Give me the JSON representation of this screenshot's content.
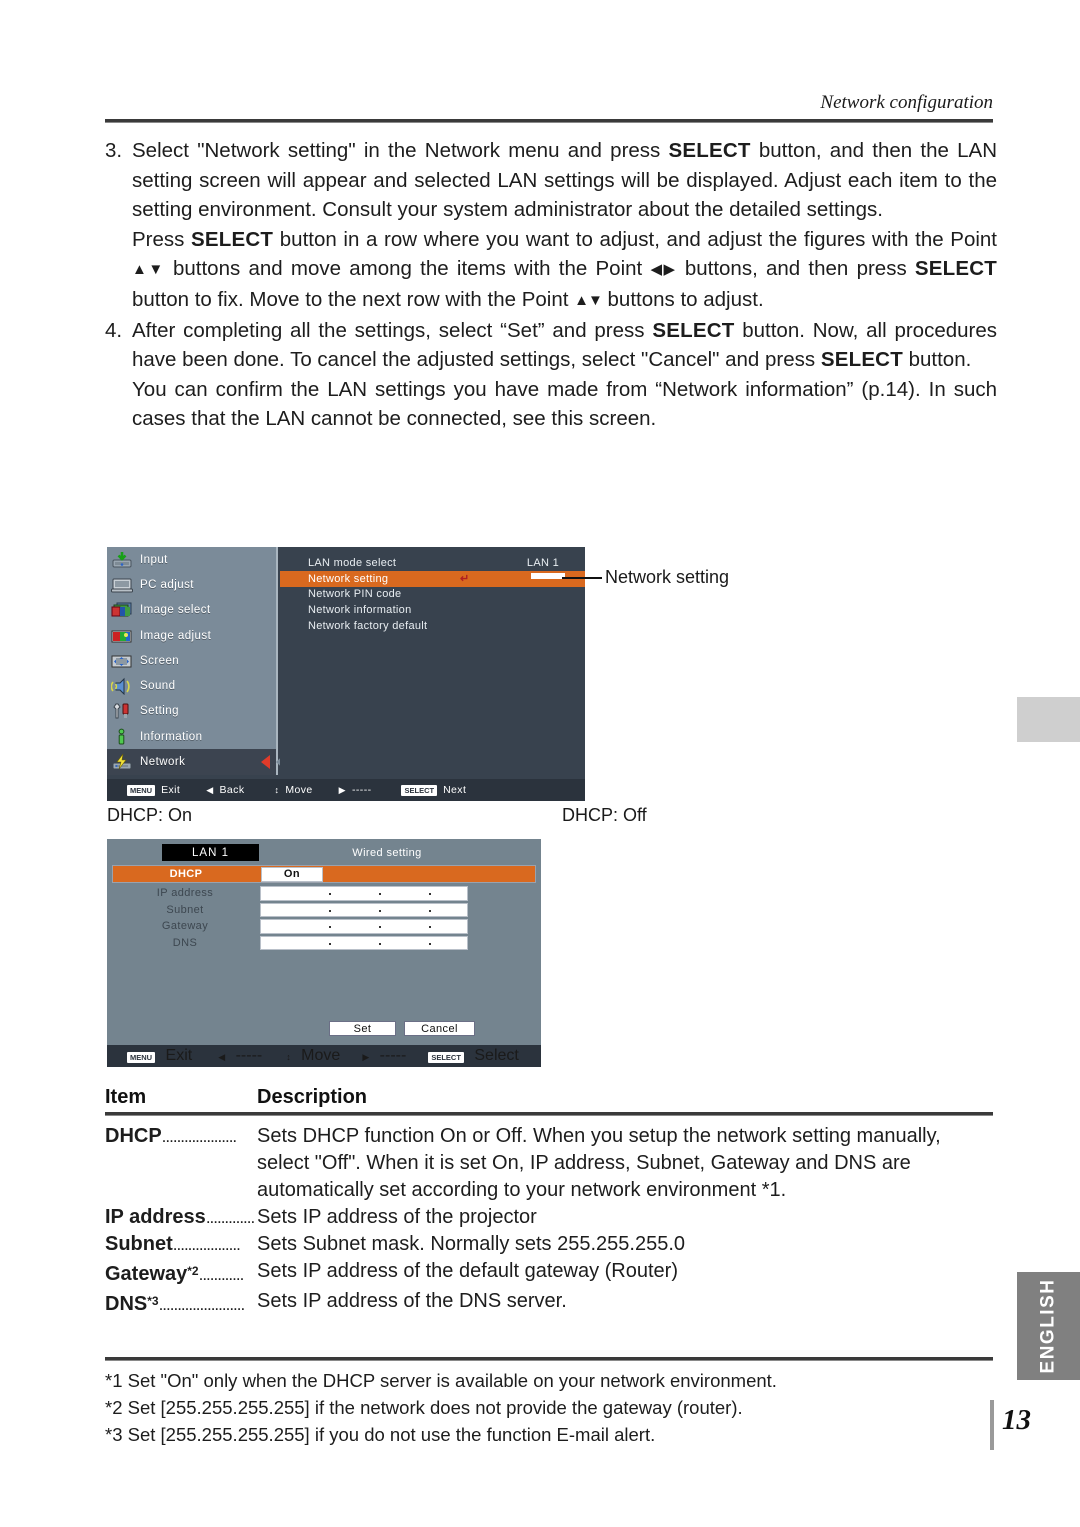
{
  "header": {
    "running_head": "Network configuration"
  },
  "steps": [
    {
      "number": "3.",
      "segments": [
        {
          "t": "Select \"Network setting\" in the Network menu and press "
        },
        {
          "t": "SELECT",
          "b": true
        },
        {
          "t": " button, and then the LAN setting screen will appear and selected LAN settings will be displayed. Adjust each item to the setting environment. Consult your system administrator about the detailed settings."
        }
      ]
    },
    {
      "number": "",
      "segments": [
        {
          "t": "Press "
        },
        {
          "t": "SELECT",
          "b": true
        },
        {
          "t": " button in a row where you want to adjust, and adjust the figures with the Point "
        },
        {
          "t": "▲▼",
          "tri": true
        },
        {
          "t": " buttons and move among the items with the Point "
        },
        {
          "t": "◀▶",
          "tri": true
        },
        {
          "t": " buttons, and then press "
        },
        {
          "t": "SELECT",
          "b": true
        },
        {
          "t": " button to fix. Move to the next row with the Point "
        },
        {
          "t": "▲▼",
          "tri": true
        },
        {
          "t": " buttons to adjust."
        }
      ]
    },
    {
      "number": "4.",
      "segments": [
        {
          "t": "After completing all the settings, select “Set” and press "
        },
        {
          "t": "SELECT",
          "b": true
        },
        {
          "t": " button. Now, all procedures have been done. To cancel the adjusted settings, select \"Cancel\" and press "
        },
        {
          "t": "SELECT",
          "b": true
        },
        {
          "t": " button."
        }
      ]
    },
    {
      "number": "",
      "segments": [
        {
          "t": "You can confirm the LAN settings you have made from “Network information” (p.14). In such cases  that the LAN cannot be connected, see this screen."
        }
      ]
    }
  ],
  "osd_menu": {
    "sidebar": [
      {
        "label": "Input",
        "icon": "input-icon"
      },
      {
        "label": "PC adjust",
        "icon": "monitor-icon"
      },
      {
        "label": "Image select",
        "icon": "image-select-icon"
      },
      {
        "label": "Image adjust",
        "icon": "image-adjust-icon"
      },
      {
        "label": "Screen",
        "icon": "screen-icon"
      },
      {
        "label": "Sound",
        "icon": "speaker-icon"
      },
      {
        "label": "Setting",
        "icon": "tools-icon"
      },
      {
        "label": "Information",
        "icon": "info-icon"
      },
      {
        "label": "Network",
        "icon": "network-icon"
      }
    ],
    "active_sidebar": "Network",
    "items": [
      {
        "label": "LAN mode select",
        "value": "LAN 1",
        "highlight": false
      },
      {
        "label": "Network setting",
        "value": "",
        "highlight": true,
        "enter": "↵"
      },
      {
        "label": "Network PIN code",
        "value": "",
        "highlight": false
      },
      {
        "label": "Network information",
        "value": "",
        "highlight": false
      },
      {
        "label": "Network factory default",
        "value": "",
        "highlight": false
      }
    ],
    "footer": [
      {
        "key": "MENU",
        "label": "Exit"
      },
      {
        "key": "◀",
        "label": "Back"
      },
      {
        "key": "↕",
        "label": "Move"
      },
      {
        "key": "▶",
        "label": "-----"
      },
      {
        "key": "SELECT",
        "label": "Next"
      }
    ],
    "callout": "Network setting"
  },
  "captions": {
    "dhcp_on": "DHCP: On",
    "dhcp_off": "DHCP: Off"
  },
  "osd_wired": {
    "lan_chip": "LAN 1",
    "title": "Wired setting",
    "rows": [
      {
        "label": "DHCP",
        "value": "On",
        "type": "select",
        "highlight": true
      },
      {
        "label": "IP address",
        "value": "",
        "type": "ip",
        "highlight": false
      },
      {
        "label": "Subnet",
        "value": "",
        "type": "ip",
        "highlight": false
      },
      {
        "label": "Gateway",
        "value": "",
        "type": "ip",
        "highlight": false
      },
      {
        "label": "DNS",
        "value": "",
        "type": "ip",
        "highlight": false
      }
    ],
    "buttons": {
      "set": "Set",
      "cancel": "Cancel"
    },
    "footer": [
      {
        "key": "MENU",
        "label": "Exit"
      },
      {
        "key": "◀",
        "label": "-----"
      },
      {
        "key": "↕",
        "label": "Move"
      },
      {
        "key": "▶",
        "label": "-----"
      },
      {
        "key": "SELECT",
        "label": "Select"
      }
    ]
  },
  "table": {
    "head": {
      "item": "Item",
      "description": "Description"
    },
    "rows": [
      {
        "item": "DHCP",
        "sup": "",
        "leader": "....................",
        "desc": "Sets DHCP function On or Off. When you setup the network setting manually, select \"Off\". When it is set On, IP address, Subnet, Gateway  and DNS are automatically set according to your network environment *1."
      },
      {
        "item": "IP address",
        "sup": "",
        "leader": ".............",
        "desc": "Sets IP address of the projector"
      },
      {
        "item": "Subnet",
        "sup": "",
        "leader": "..................",
        "desc": "Sets Subnet mask. Normally sets 255.255.255.0"
      },
      {
        "item": "Gateway",
        "sup": "*2",
        "leader": "............",
        "desc": "Sets IP address of the default gateway (Router)"
      },
      {
        "item": "DNS",
        "sup": "*3",
        "leader": ".......................",
        "desc": "Sets IP address of the DNS server."
      }
    ]
  },
  "footnotes": [
    "*1 Set \"On\" only when the DHCP server is available on your network environment.",
    "*2 Set [255.255.255.255] if the network does not provide the gateway (router).",
    "*3 Set [255.255.255.255] if you do not use the function E-mail alert."
  ],
  "edge": {
    "language_tab": "ENGLISH",
    "page_number": "13"
  },
  "colors": {
    "osd_highlight": "#d9691f",
    "osd_dark": "#38424e",
    "osd_sidebar": "#7b8b99",
    "osd_dialog": "#74848f",
    "osd_bar": "#2b333d",
    "language_tab": "#808080"
  }
}
